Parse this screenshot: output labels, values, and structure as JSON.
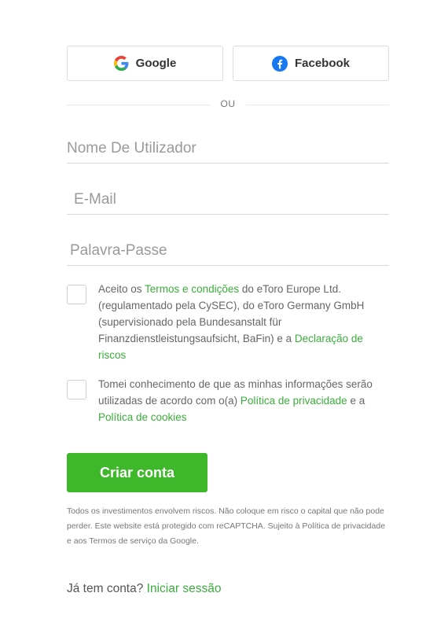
{
  "social": {
    "google_label": "Google",
    "facebook_label": "Facebook"
  },
  "divider_text": "OU",
  "fields": {
    "username_placeholder": "Nome De Utilizador",
    "email_placeholder": "E-Mail",
    "password_placeholder": "Palavra-Passe"
  },
  "terms": {
    "pre": "Aceito os ",
    "link1": "Termos e condições",
    "mid": " do eToro Europe Ltd. (regulamentado pela CySEC), do eToro Germany GmbH (supervisionado pela Bundesanstalt für Finanzdienstleistungsaufsicht, BaFin) e a ",
    "link2": "Declaração de riscos"
  },
  "privacy": {
    "pre": "Tomei conhecimento de que as minhas informações serão utilizadas de acordo com o(a) ",
    "link1": "Política de privacidade",
    "mid": " e a ",
    "link2": "Política de cookies"
  },
  "create_button_label": "Criar conta",
  "disclaimer": "Todos os investimentos envolvem riscos. Não coloque em risco o capital que não pode perder. Este website está protegido com reCAPTCHA. Sujeito à Política de privacidade e aos Termos de serviço da Google.",
  "login": {
    "question": "Já tem conta? ",
    "link": "Iniciar sessão"
  },
  "colors": {
    "accent_green": "#3eb72b",
    "link_green": "#3bad3b",
    "facebook_blue": "#1877f2"
  }
}
